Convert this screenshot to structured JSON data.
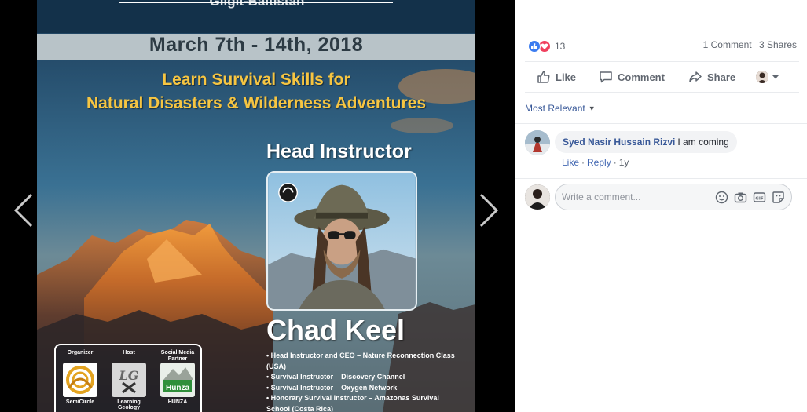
{
  "poster": {
    "region": "Gilgit-Baltistan",
    "date": "March 7th - 14th, 2018",
    "tagline_1": "Learn Survival  Skills for",
    "tagline_2": "Natural Disasters & Wilderness Adventures",
    "instructor_heading": "Head Instructor",
    "instructor_name": "Chad Keel",
    "bio": [
      "Head Instructor and CEO – Nature Reconnection Class (USA)",
      "Survival Instructor – Discovery Channel",
      "Survival Instructor – Oxygen Network",
      "Honorary Survival Instructor –  Amazonas Survival School (Costa Rica)"
    ],
    "partners": [
      {
        "role": "Organizer",
        "name": "SemiCircle"
      },
      {
        "role": "Host",
        "name": "Learning Geology"
      },
      {
        "role": "Social Media Partner",
        "name": "HUNZA"
      }
    ],
    "host_logo_text": "LG",
    "social_logo_text": "Hunza"
  },
  "post_stats": {
    "reaction_count": "13",
    "comments": "1 Comment",
    "shares": "3 Shares"
  },
  "actions": {
    "like": "Like",
    "comment": "Comment",
    "share": "Share"
  },
  "sort": {
    "label": "Most Relevant"
  },
  "comments": [
    {
      "author": "Syed Nasir Hussain Rizvi",
      "text": "I am coming",
      "like": "Like",
      "reply": "Reply",
      "time": "1y"
    }
  ],
  "composer": {
    "placeholder": "Write a comment..."
  },
  "icons": {
    "prev": "chevron-left-icon",
    "next": "chevron-right-icon",
    "like_reaction": "thumbs-up-icon",
    "love_reaction": "heart-icon",
    "emoji": "smiley-icon",
    "camera": "camera-icon",
    "gif": "gif-icon",
    "sticker": "sticker-icon"
  },
  "colors": {
    "link": "#385898",
    "muted": "#616770",
    "like_blue": "#3b7cf0",
    "love_red": "#f0405e",
    "tagline_yellow": "#f6c542"
  }
}
